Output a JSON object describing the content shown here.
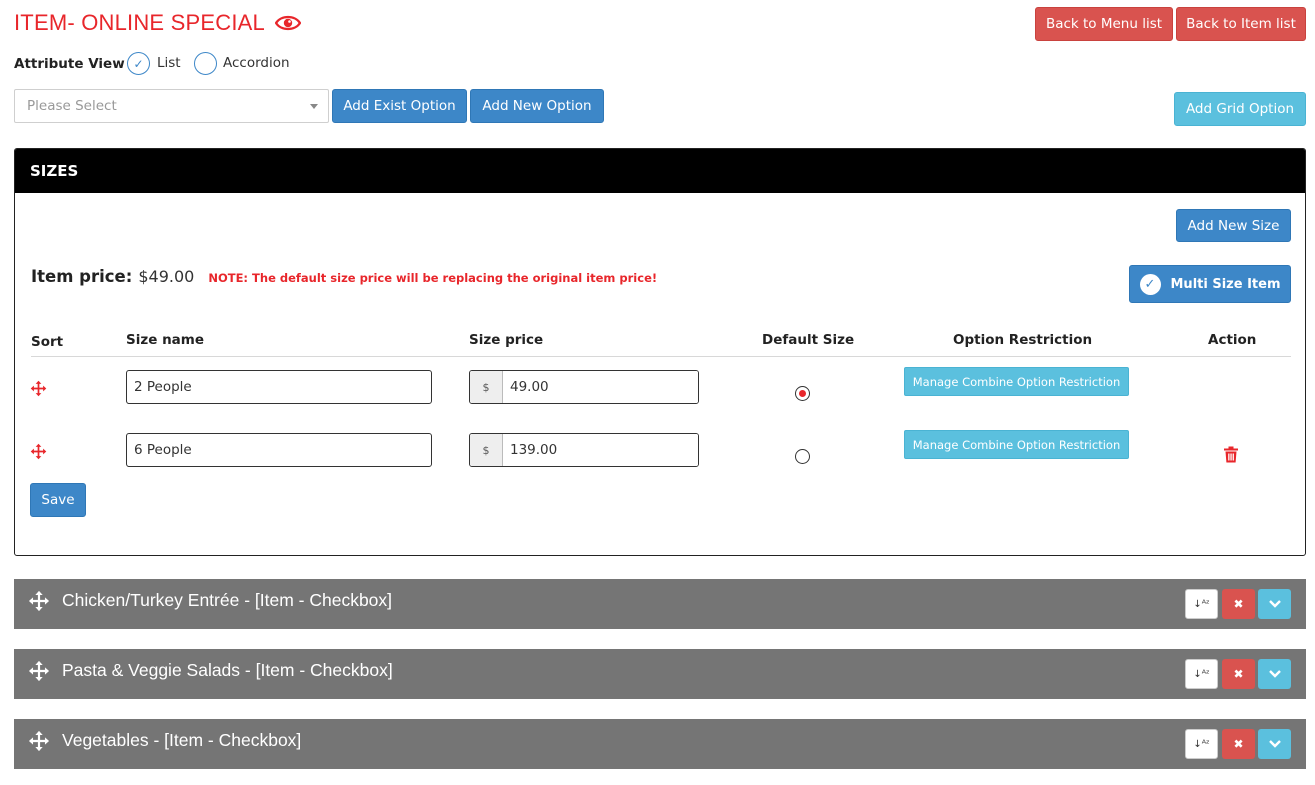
{
  "page": {
    "title": "ITEM- ONLINE SPECIAL",
    "back_menu_label": "Back to Menu list",
    "back_item_label": "Back to Item list"
  },
  "attribute_view": {
    "label": "Attribute View",
    "options": [
      "List",
      "Accordion"
    ],
    "selected": "List"
  },
  "toolbar": {
    "select_placeholder": "Please Select",
    "add_exist_label": "Add Exist Option",
    "add_new_label": "Add New Option",
    "add_grid_label": "Add Grid Option"
  },
  "sizes": {
    "header": "SIZES",
    "add_size_label": "Add New Size",
    "item_price_label": "Item price:",
    "item_price_value": "$49.00",
    "note": "NOTE: The default size price will be replacing the original item price!",
    "multi_size_label": "Multi Size Item",
    "columns": [
      "Sort",
      "Size name",
      "Size price",
      "Default Size",
      "Option Restriction",
      "Action"
    ],
    "currency_symbol": "$",
    "rows": [
      {
        "name": "2 People",
        "price": "49.00",
        "default": true,
        "restriction_label": "Manage Combine Option Restriction",
        "deletable": false
      },
      {
        "name": "6 People",
        "price": "139.00",
        "default": false,
        "restriction_label": "Manage Combine Option Restriction",
        "deletable": true
      }
    ],
    "save_label": "Save"
  },
  "option_groups": [
    {
      "title": "Chicken/Turkey Entrée - [Item - Checkbox]"
    },
    {
      "title": "Pasta & Veggie Salads - [Item - Checkbox]"
    },
    {
      "title": "Vegetables - [Item - Checkbox]"
    }
  ],
  "colors": {
    "accent_red": "#e8262b",
    "primary_blue": "#3d87c8",
    "info_cyan": "#5bc0de",
    "danger_red": "#d9534f",
    "bar_gray": "#757575"
  }
}
